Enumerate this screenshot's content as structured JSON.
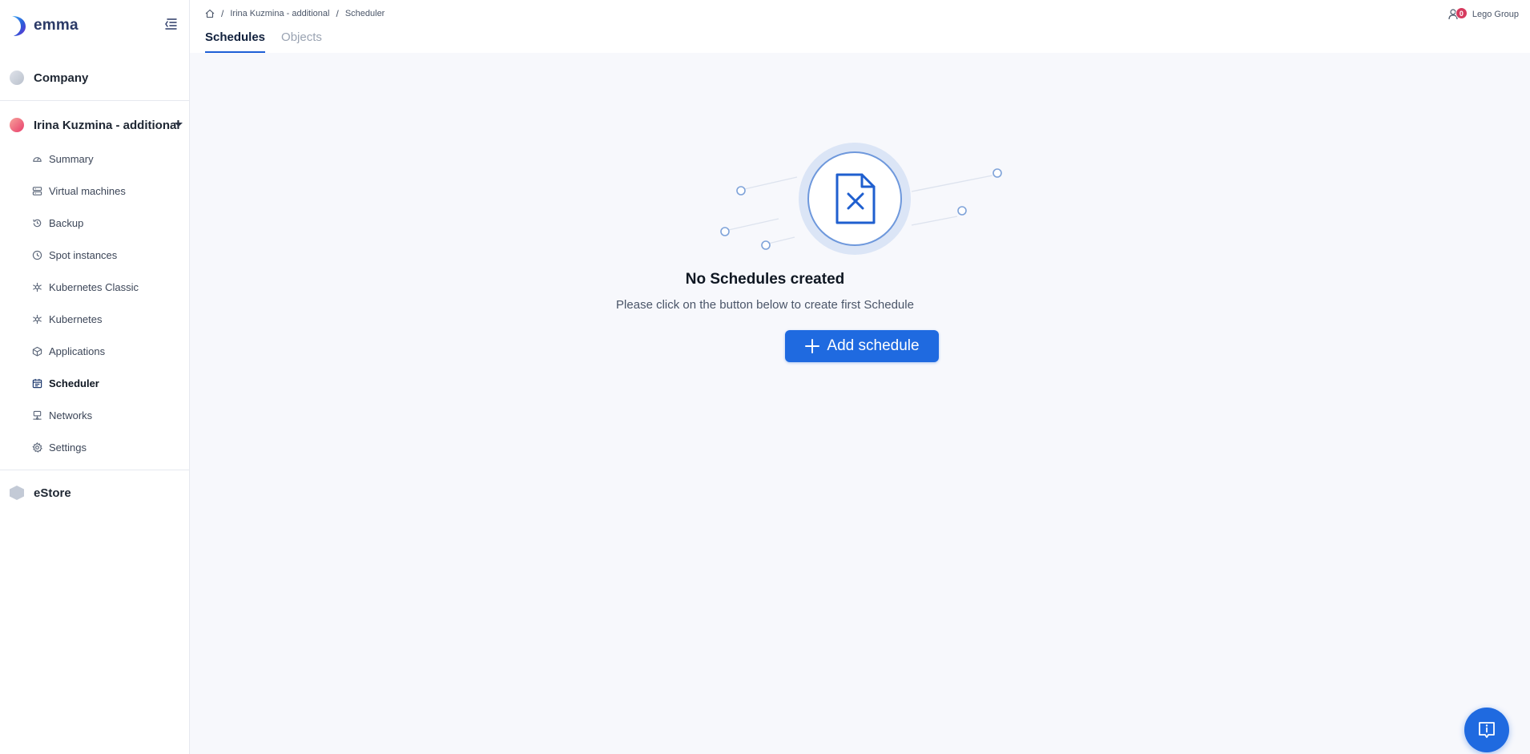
{
  "brand": {
    "name": "emma",
    "logo_icon": "emma-logo-icon"
  },
  "sidebar": {
    "collapse_icon": "collapse-menu-icon",
    "projects": [
      {
        "label": "Company",
        "icon": "project-dot-icon"
      },
      {
        "label": "Irina Kuzmina - additional",
        "icon": "project-dot-icon",
        "expanded": true
      },
      {
        "label": "eStore",
        "icon": "hexagon-icon"
      }
    ],
    "items": [
      {
        "label": "Summary",
        "icon": "dashboard-gauge-icon"
      },
      {
        "label": "Virtual machines",
        "icon": "server-icon"
      },
      {
        "label": "Backup",
        "icon": "history-icon"
      },
      {
        "label": "Spot instances",
        "icon": "clock-icon"
      },
      {
        "label": "Kubernetes Classic",
        "icon": "kubernetes-icon"
      },
      {
        "label": "Kubernetes",
        "icon": "kubernetes-icon"
      },
      {
        "label": "Applications",
        "icon": "cube-icon"
      },
      {
        "label": "Scheduler",
        "icon": "calendar-icon",
        "active": true
      },
      {
        "label": "Networks",
        "icon": "network-icon"
      },
      {
        "label": "Settings",
        "icon": "gear-icon"
      }
    ]
  },
  "breadcrumb": {
    "home_icon": "home-icon",
    "items": [
      "Irina Kuzmina - additional",
      "Scheduler"
    ],
    "separator": "/"
  },
  "tabs": [
    {
      "label": "Schedules",
      "active": true
    },
    {
      "label": "Objects",
      "active": false
    }
  ],
  "user": {
    "icon": "user-icon",
    "notifications": "0",
    "org_name": "Lego Group"
  },
  "empty_state": {
    "icon": "file-x-icon",
    "title": "No Schedules created",
    "subtitle": "Please click on the button below to create first Schedule",
    "button_label": "Add schedule",
    "button_icon": "plus-icon"
  },
  "help": {
    "icon": "info-chat-icon"
  },
  "colors": {
    "accent": "#1f6ae0",
    "badge": "#d63a5e",
    "background": "#f7f8fc",
    "sidebar_bg": "#ffffff"
  }
}
